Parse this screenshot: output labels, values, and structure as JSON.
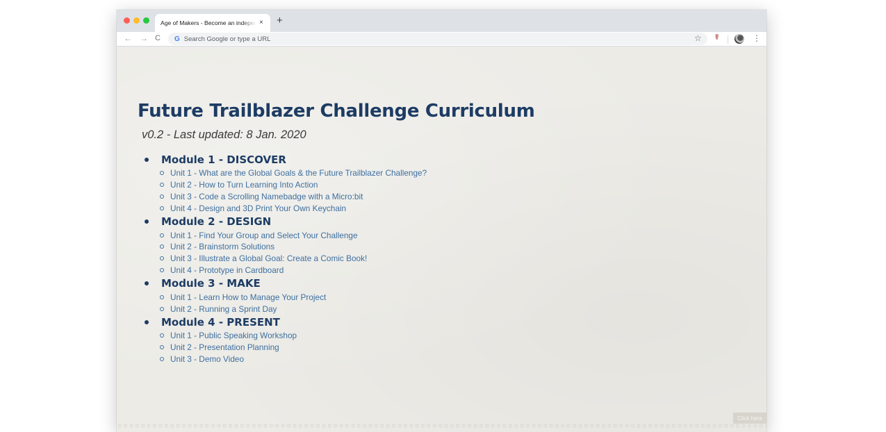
{
  "browser": {
    "tab_title": "Age of Makers - Become an independent",
    "tab_close": "×",
    "new_tab": "+",
    "nav_back": "←",
    "nav_forward": "→",
    "nav_reload": "C",
    "omnibox_placeholder": "Search Google or type a URL",
    "google_logo": "G",
    "star": "☆",
    "extension": "☤",
    "menu": "⋮"
  },
  "page": {
    "title": "Future Trailblazer Challenge Curriculum",
    "subtitle": "v0.2 - Last updated: 8 Jan. 2020",
    "modules": [
      {
        "title": "Module 1 - DISCOVER",
        "units": [
          "Unit 1 - What are the Global Goals & the Future Trailblazer Challenge?",
          "Unit 2 - How to Turn Learning Into Action",
          "Unit 3 - Code a Scrolling Namebadge with a Micro:bit",
          "Unit 4 - Design and 3D Print Your Own Keychain"
        ]
      },
      {
        "title": "Module 2 - DESIGN",
        "units": [
          "Unit 1 - Find Your Group and Select Your Challenge",
          "Unit 2 - Brainstorm Solutions",
          "Unit 3 - Illustrate a Global Goal: Create a Comic Book!",
          "Unit 4 - Prototype in Cardboard"
        ]
      },
      {
        "title": "Module 3 - MAKE",
        "units": [
          "Unit 1 - Learn How to Manage Your Project",
          "Unit 2 - Running a Sprint Day"
        ]
      },
      {
        "title": "Module 4 - PRESENT",
        "units": [
          "Unit 1 - Public Speaking Workshop",
          "Unit 2 - Presentation Planning",
          "Unit 3 - Demo Video"
        ]
      }
    ],
    "click_here": "Click here"
  },
  "colors": {
    "heading": "#1d3c64",
    "link": "#3e6fa0",
    "background": "#ecebe6"
  }
}
